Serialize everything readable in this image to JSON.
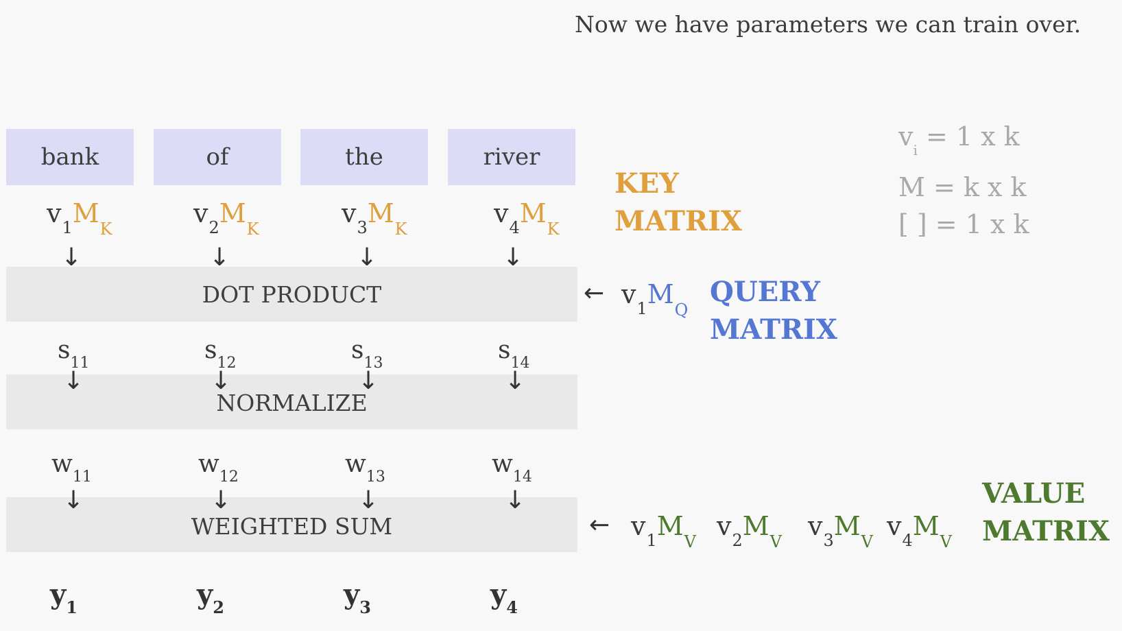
{
  "caption": "Now we have parameters we can train over.",
  "words": [
    "bank",
    "of",
    "the",
    "river"
  ],
  "key_label": {
    "line1": "KEY",
    "line2": "MATRIX"
  },
  "query_label": {
    "line1": "QUERY",
    "line2": "MATRIX"
  },
  "value_label": {
    "line1": "VALUE",
    "line2": "MATRIX"
  },
  "bands": {
    "dot": "DOT PRODUCT",
    "normalize": "NORMALIZE",
    "weighted": "WEIGHTED SUM"
  },
  "key_exprs": [
    {
      "v": "v",
      "i": "1",
      "m": "M",
      "s": "K"
    },
    {
      "v": "v",
      "i": "2",
      "m": "M",
      "s": "K"
    },
    {
      "v": "v",
      "i": "3",
      "m": "M",
      "s": "K"
    },
    {
      "v": "v",
      "i": "4",
      "m": "M",
      "s": "K"
    }
  ],
  "query_expr": {
    "v": "v",
    "i": "1",
    "m": "M",
    "s": "Q"
  },
  "value_exprs": [
    {
      "v": "v",
      "i": "1",
      "m": "M",
      "s": "V"
    },
    {
      "v": "v",
      "i": "2",
      "m": "M",
      "s": "V"
    },
    {
      "v": "v",
      "i": "3",
      "m": "M",
      "s": "V"
    },
    {
      "v": "v",
      "i": "4",
      "m": "M",
      "s": "V"
    }
  ],
  "scores": [
    {
      "b": "s",
      "i": "11"
    },
    {
      "b": "s",
      "i": "12"
    },
    {
      "b": "s",
      "i": "13"
    },
    {
      "b": "s",
      "i": "14"
    }
  ],
  "weights": [
    {
      "b": "w",
      "i": "11"
    },
    {
      "b": "w",
      "i": "12"
    },
    {
      "b": "w",
      "i": "13"
    },
    {
      "b": "w",
      "i": "14"
    }
  ],
  "outputs": [
    {
      "b": "y",
      "i": "1"
    },
    {
      "b": "y",
      "i": "2"
    },
    {
      "b": "y",
      "i": "3"
    },
    {
      "b": "y",
      "i": "4"
    }
  ],
  "dims": {
    "line1_base": "v",
    "line1_sub": "i",
    "line1_rest": " = 1 x k",
    "line2": "M = k x k",
    "line3": "[ ] = 1 x k"
  },
  "arrow_down": "↓",
  "arrow_left": "←",
  "colors": {
    "key": "#df9f3d",
    "query": "#5477d3",
    "value": "#4d7a2f",
    "word_box": "#dcdcf7",
    "band": "#e9e9e9"
  }
}
